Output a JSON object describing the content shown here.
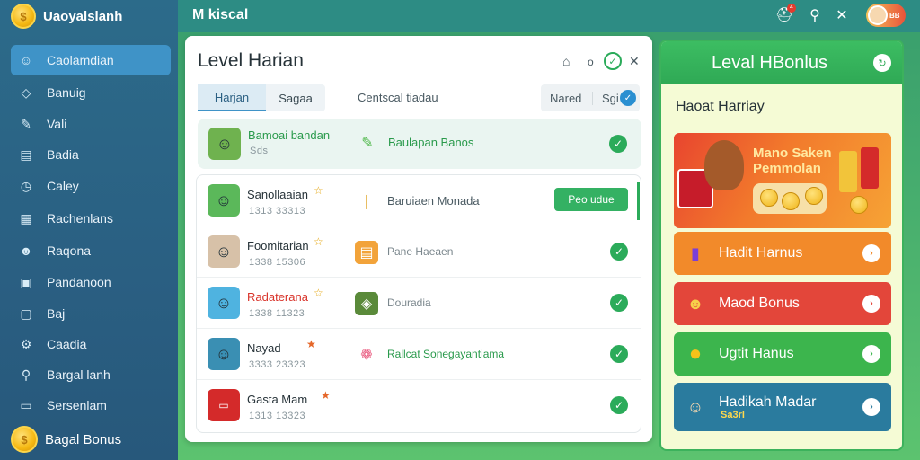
{
  "sidebar": {
    "brand": "Uaoyalslanh",
    "items": [
      {
        "label": "Caolamdian",
        "icon": "user-icon",
        "glyph": "☺"
      },
      {
        "label": "Banuig",
        "icon": "tag-icon",
        "glyph": "◇"
      },
      {
        "label": "Vali",
        "icon": "edit-icon",
        "glyph": "✎"
      },
      {
        "label": "Badia",
        "icon": "document-icon",
        "glyph": "▤"
      },
      {
        "label": "Caley",
        "icon": "clock-icon",
        "glyph": "◷"
      },
      {
        "label": "Rachenlans",
        "icon": "chart-icon",
        "glyph": "▦"
      },
      {
        "label": "Raqona",
        "icon": "people-icon",
        "glyph": "☻"
      },
      {
        "label": "Pandanoon",
        "icon": "gift-icon",
        "glyph": "▣"
      },
      {
        "label": "Baj",
        "icon": "wallet-icon",
        "glyph": "▢"
      },
      {
        "label": "Caadia",
        "icon": "settings-icon",
        "glyph": "⚙"
      },
      {
        "label": "Bargal lanh",
        "icon": "search-icon",
        "glyph": "⚲"
      },
      {
        "label": "Sersenlam",
        "icon": "chat-icon",
        "glyph": "▭"
      }
    ],
    "bonus_label": "Bagal Bonus"
  },
  "topbar": {
    "title": "M kiscal",
    "notif_count": "4",
    "avatar_tag": "BB"
  },
  "panel": {
    "title": "Level Harian",
    "tabs": [
      "Harjan",
      "Sagaa"
    ],
    "filter_label": "Centscal tiadau",
    "select": {
      "option1": "Nared",
      "option2": "Sgi"
    },
    "header_row": {
      "name": "Bamoai bandan",
      "sub": "Sds",
      "item": "Baulapan Banos"
    },
    "rows": [
      {
        "name": "Sanollaaian",
        "sub": "1313  33313",
        "item": "Baruiaen Monada",
        "action": "Peo udue",
        "name_color": "#263238",
        "item_green": false
      },
      {
        "name": "Foomitarian",
        "sub": "1338  15306",
        "item": "Pane Haeaen",
        "action": "",
        "name_color": "#263238",
        "item_green": false
      },
      {
        "name": "Radaterana",
        "sub": "1338  11323",
        "item": "Douradia",
        "action": "",
        "name_color": "#d9342b",
        "item_green": false
      },
      {
        "name": "Nayad",
        "sub": "3333  23323",
        "item": "Rallcat Sonegayantiama",
        "action": "",
        "name_color": "#263238",
        "item_green": true
      },
      {
        "name": "Gasta Mam",
        "sub": "1313  13323",
        "item": "",
        "action": "",
        "name_color": "#263238",
        "item_green": false
      }
    ]
  },
  "bonus": {
    "title": "Leval HBonlus",
    "subtitle": "Haoat Harriay",
    "promo_text": "Mano Saken Pemmolan",
    "cards": [
      {
        "label": "Hadit Harnus",
        "color": "#f28a2a",
        "icon": "bars-icon",
        "glyph": "▮",
        "sub": ""
      },
      {
        "label": "Maod Bonus",
        "color": "#e3463a",
        "icon": "mask-icon",
        "glyph": "☻",
        "sub": ""
      },
      {
        "label": "Ugtit Hanus",
        "color": "#3cb54d",
        "icon": "coin-icon",
        "glyph": "●",
        "sub": ""
      },
      {
        "label": "Hadikah Madar",
        "color": "#2a7b9e",
        "icon": "mascot-icon",
        "glyph": "☺",
        "sub": "Sa3rl"
      }
    ]
  },
  "colors": {
    "accent": "#3f93c7",
    "success": "#2bab5a",
    "sidebar_bg": "#2a5f82",
    "topbar_bg": "#2d8c84"
  }
}
